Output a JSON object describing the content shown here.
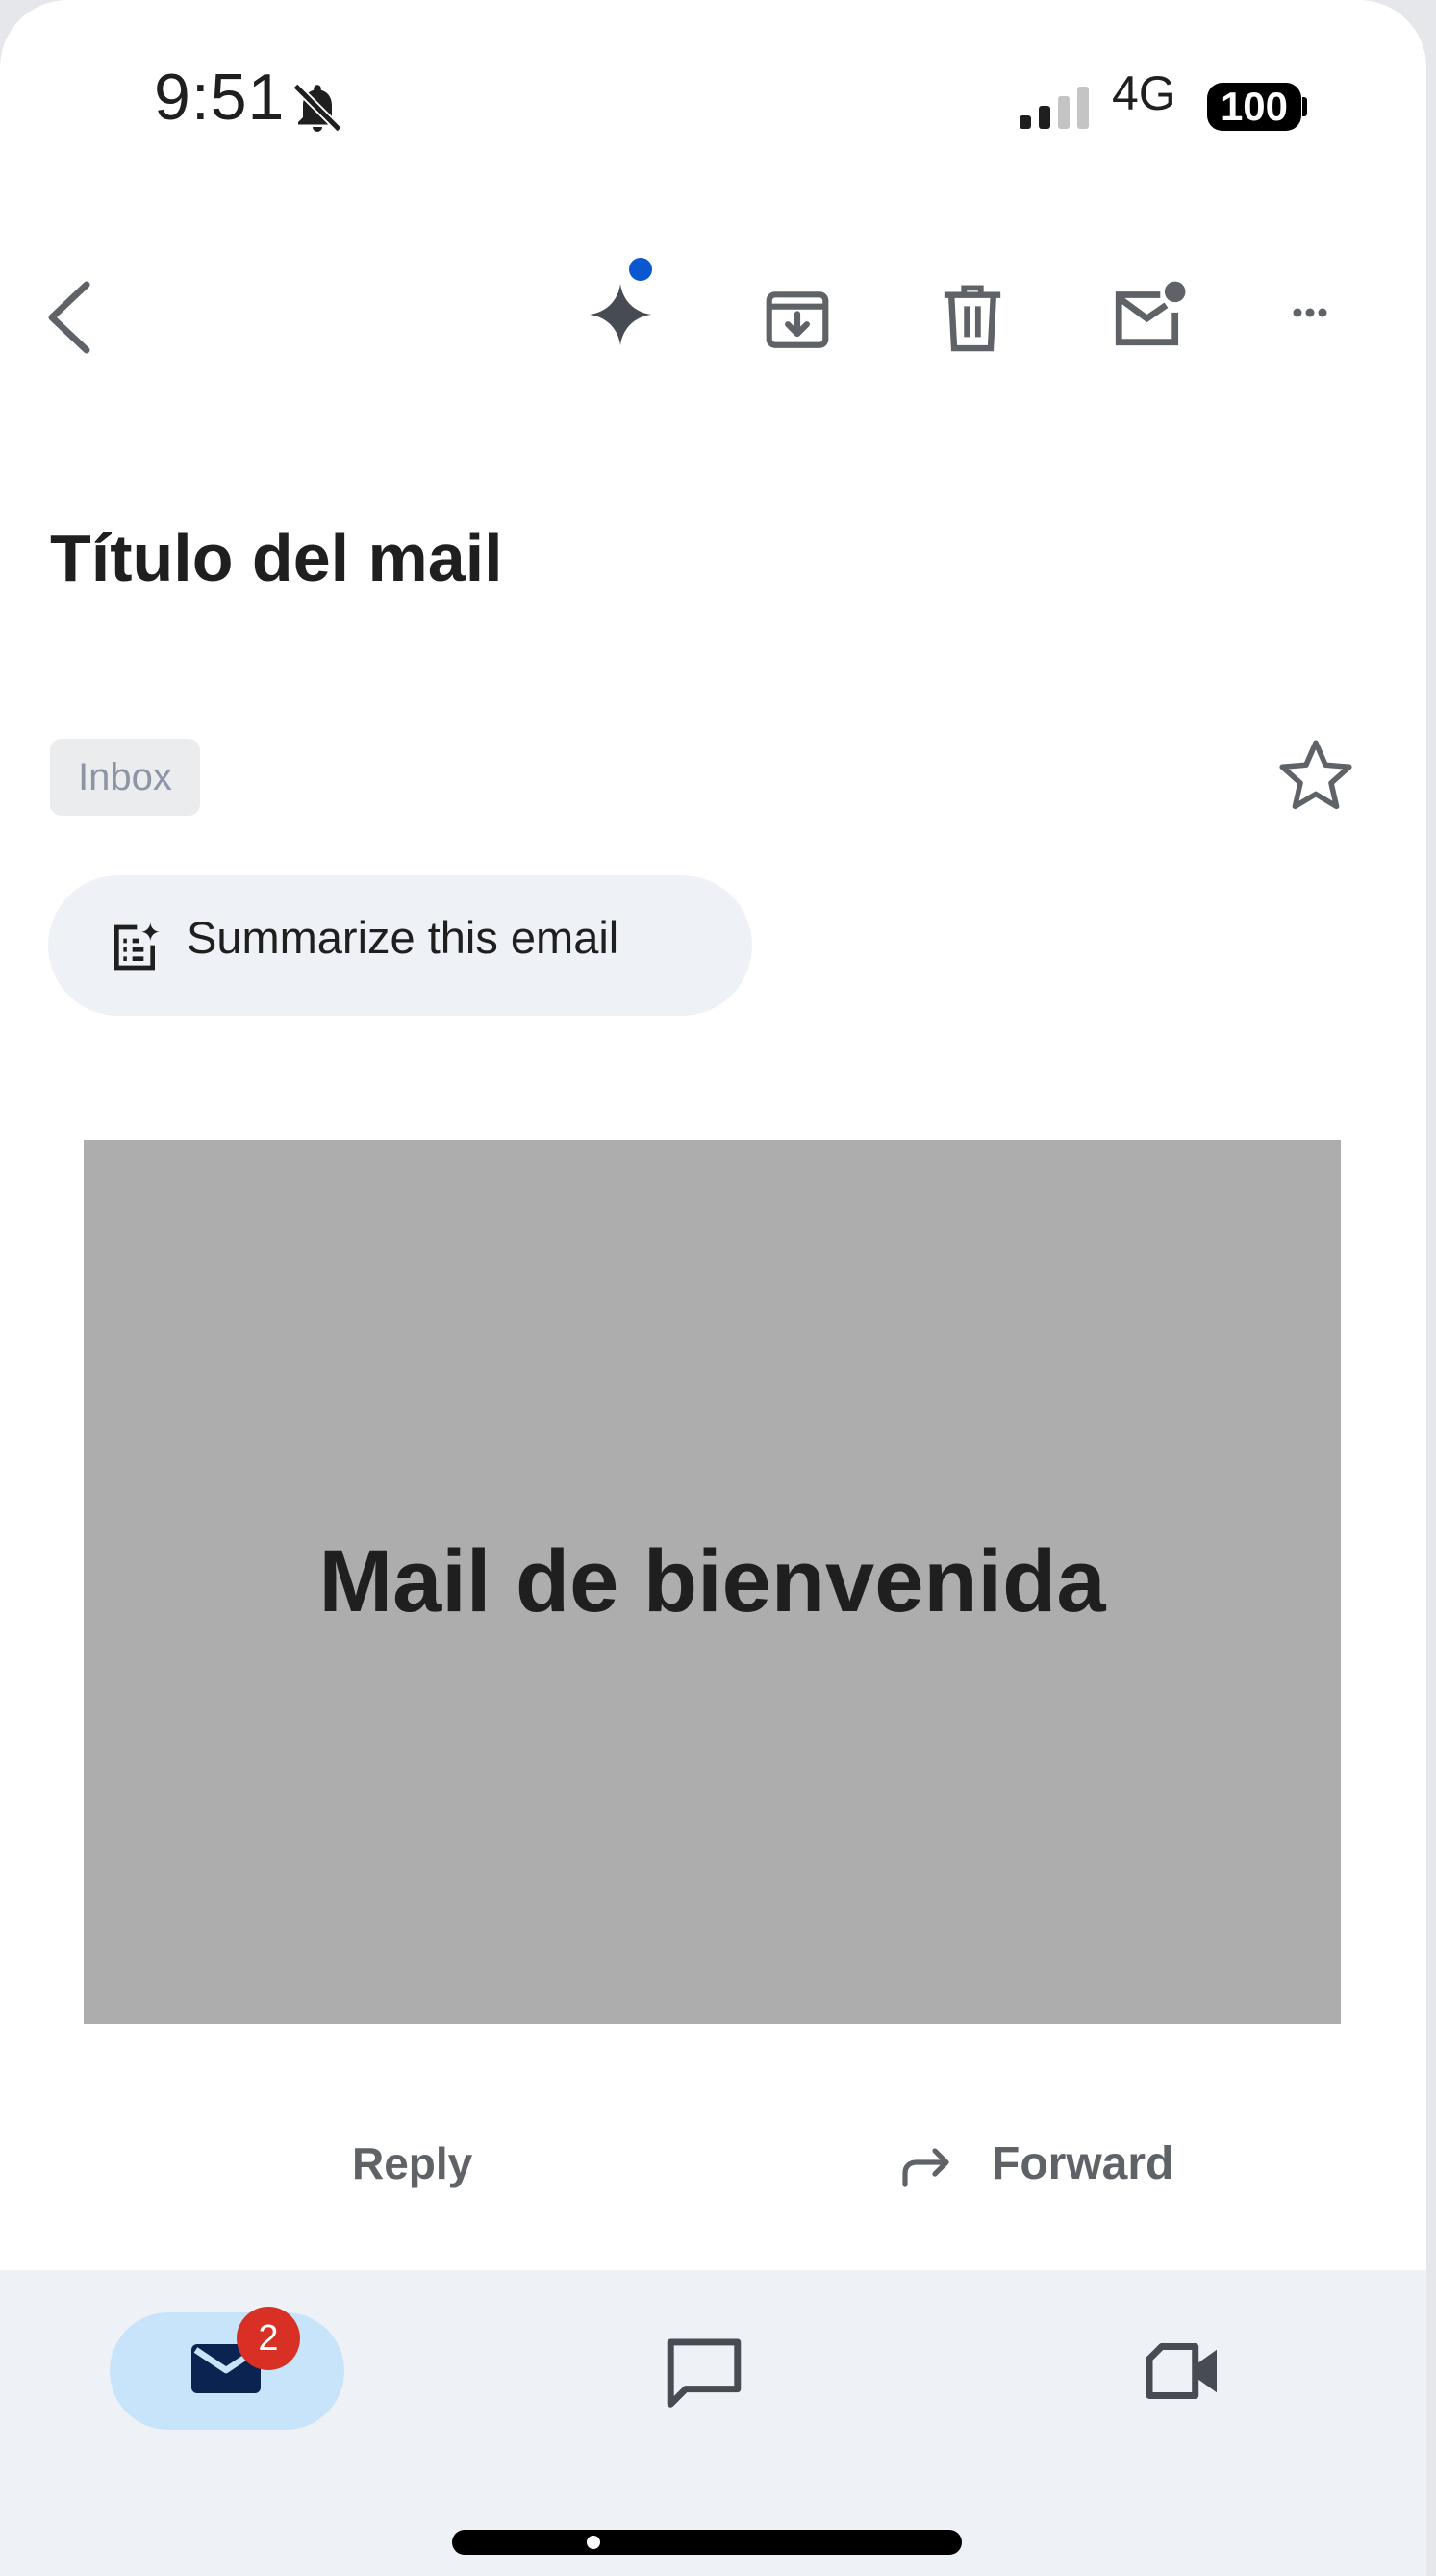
{
  "status_bar": {
    "time": "9:51",
    "network": "4G",
    "battery": "100",
    "icons": [
      "bell-muted-icon",
      "signal-icon"
    ]
  },
  "toolbar": {
    "icons": [
      "back-icon",
      "gemini-sparkle-icon",
      "archive-icon",
      "delete-icon",
      "mark-unread-icon",
      "more-icon"
    ],
    "accent_dot_color": "#0b57d0"
  },
  "email": {
    "subject": "Título del mail",
    "label_chip": "Inbox",
    "summarize_label": "Summarize this email",
    "banner_text": "Mail de bienvenida"
  },
  "actions": {
    "reply": "Reply",
    "forward": "Forward"
  },
  "bottom_nav": {
    "items": [
      {
        "name": "mail",
        "icon": "mail-icon",
        "badge": "2",
        "active": true
      },
      {
        "name": "chat",
        "icon": "chat-icon"
      },
      {
        "name": "meet",
        "icon": "video-icon"
      }
    ],
    "active_color": "#c8e4fb",
    "badge_color": "#d93025"
  }
}
